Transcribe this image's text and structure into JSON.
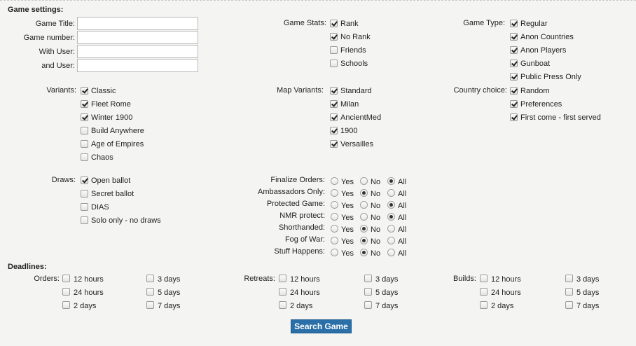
{
  "headings": {
    "game_settings": "Game settings:",
    "deadlines": "Deadlines:"
  },
  "text_fields": [
    {
      "label": "Game Title:",
      "value": ""
    },
    {
      "label": "Game number:",
      "value": ""
    },
    {
      "label": "With User:",
      "value": ""
    },
    {
      "label": "and User:",
      "value": ""
    }
  ],
  "game_stats": {
    "label": "Game Stats:",
    "options": [
      {
        "label": "Rank",
        "checked": true
      },
      {
        "label": "No Rank",
        "checked": true
      },
      {
        "label": "Friends",
        "checked": false
      },
      {
        "label": "Schools",
        "checked": false
      }
    ]
  },
  "game_type": {
    "label": "Game Type:",
    "options": [
      {
        "label": "Regular",
        "checked": true
      },
      {
        "label": "Anon Countries",
        "checked": true
      },
      {
        "label": "Anon Players",
        "checked": true
      },
      {
        "label": "Gunboat",
        "checked": true
      },
      {
        "label": "Public Press Only",
        "checked": true
      }
    ]
  },
  "variants": {
    "label": "Variants:",
    "options": [
      {
        "label": "Classic",
        "checked": true
      },
      {
        "label": "Fleet Rome",
        "checked": true
      },
      {
        "label": "Winter 1900",
        "checked": true
      },
      {
        "label": "Build Anywhere",
        "checked": false
      },
      {
        "label": "Age of Empires",
        "checked": false
      },
      {
        "label": "Chaos",
        "checked": false
      }
    ]
  },
  "map_variants": {
    "label": "Map Variants:",
    "options": [
      {
        "label": "Standard",
        "checked": true
      },
      {
        "label": "Milan",
        "checked": true
      },
      {
        "label": "AncientMed",
        "checked": true
      },
      {
        "label": "1900",
        "checked": true
      },
      {
        "label": "Versailles",
        "checked": true
      }
    ]
  },
  "country_choice": {
    "label": "Country choice:",
    "options": [
      {
        "label": "Random",
        "checked": true
      },
      {
        "label": "Preferences",
        "checked": true
      },
      {
        "label": "First come - first served",
        "checked": true
      }
    ]
  },
  "draws": {
    "label": "Draws:",
    "options": [
      {
        "label": "Open ballot",
        "checked": true
      },
      {
        "label": "Secret ballot",
        "checked": false
      },
      {
        "label": "DIAS",
        "checked": false
      },
      {
        "label": "Solo only - no draws",
        "checked": false
      }
    ]
  },
  "radio_choices": [
    "Yes",
    "No",
    "All"
  ],
  "radio_rows": [
    {
      "label": "Finalize Orders:",
      "selected": "All"
    },
    {
      "label": "Ambassadors Only:",
      "selected": "No"
    },
    {
      "label": "Protected Game:",
      "selected": "All"
    },
    {
      "label": "NMR protect:",
      "selected": "All"
    },
    {
      "label": "Shorthanded:",
      "selected": "No"
    },
    {
      "label": "Fog of War:",
      "selected": "No"
    },
    {
      "label": "Stuff Happens:",
      "selected": "No"
    }
  ],
  "deadline_groups": [
    {
      "label": "Orders:",
      "options": [
        "12 hours",
        "24 hours",
        "2 days",
        "3 days",
        "5 days",
        "7 days"
      ]
    },
    {
      "label": "Retreats:",
      "options": [
        "12 hours",
        "24 hours",
        "2 days",
        "3 days",
        "5 days",
        "7 days"
      ]
    },
    {
      "label": "Builds:",
      "options": [
        "12 hours",
        "24 hours",
        "2 days",
        "3 days",
        "5 days",
        "7 days"
      ]
    }
  ],
  "search_button": "Search Game"
}
